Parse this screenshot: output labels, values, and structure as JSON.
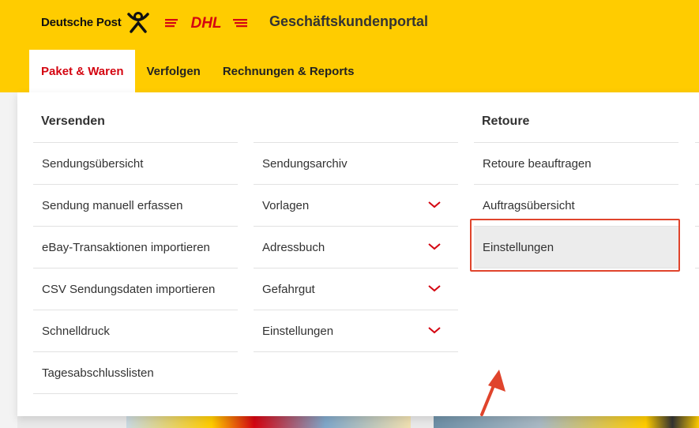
{
  "header": {
    "brand_text": "Deutsche Post",
    "dhl_logo_text": "DHL",
    "portal_title": "Geschäftskundenportal",
    "colors": {
      "background": "#ffcc00",
      "accent": "#d40511"
    }
  },
  "nav": {
    "tabs": [
      {
        "label": "Paket & Waren",
        "active": true
      },
      {
        "label": "Verfolgen",
        "active": false
      },
      {
        "label": "Rechnungen & Reports",
        "active": false
      }
    ]
  },
  "menu": {
    "versenden": {
      "heading": "Versenden",
      "items_left": [
        "Sendungsübersicht",
        "Sendung manuell erfassen",
        "eBay-Transaktionen importieren",
        "CSV Sendungsdaten importieren",
        "Schnelldruck",
        "Tagesabschlusslisten"
      ],
      "items_right": [
        {
          "label": "Sendungsarchiv",
          "icon": ""
        },
        {
          "label": "Vorlagen",
          "icon": "chevron-down-icon"
        },
        {
          "label": "Adressbuch",
          "icon": "chevron-down-icon"
        },
        {
          "label": "Gefahrgut",
          "icon": "chevron-down-icon"
        },
        {
          "label": "Einstellungen",
          "icon": "chevron-down-icon"
        }
      ]
    },
    "retoure": {
      "heading": "Retoure",
      "items": [
        "Retoure beauftragen",
        "Auftragsübersicht",
        "Einstellungen"
      ],
      "highlighted_item": "Einstellungen",
      "annotation_color": "#e0442c"
    }
  }
}
